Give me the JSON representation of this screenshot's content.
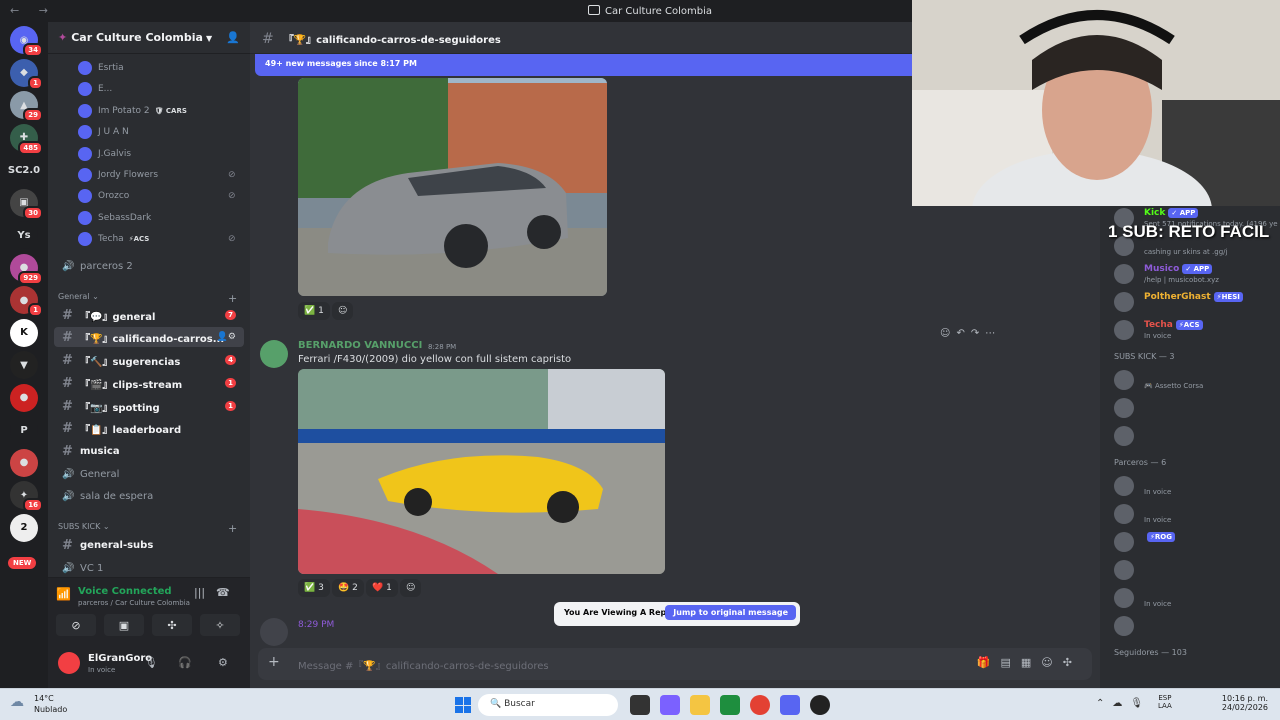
{
  "window": {
    "title": "Car Culture Colombia",
    "nav": "← →"
  },
  "rail": [
    {
      "label": "◉",
      "badge": "34",
      "color": "#5865f2"
    },
    {
      "label": "◆",
      "badge": "1",
      "color": "#3c5fae"
    },
    {
      "label": "▲",
      "badge": "29",
      "color": "#8a9aa8"
    },
    {
      "label": "✚",
      "badge": "485",
      "color": "#345e4a"
    },
    {
      "label": "SC2.0",
      "badge": "",
      "color": "#1e1f22"
    },
    {
      "label": "▣",
      "badge": "30",
      "color": "#444"
    },
    {
      "label": "Ys",
      "badge": "",
      "color": "#1e1f22"
    },
    {
      "label": "●",
      "badge": "929",
      "color": "#b04a9a"
    },
    {
      "label": "●",
      "badge": "1",
      "color": "#a33"
    },
    {
      "label": "K",
      "badge": "",
      "color": "#fff"
    },
    {
      "label": "▼",
      "badge": "",
      "color": "#222"
    },
    {
      "label": "●",
      "badge": "",
      "color": "#c22"
    },
    {
      "label": "P",
      "badge": "",
      "color": "#1e1f22"
    },
    {
      "label": "●",
      "badge": "",
      "color": "#c44"
    },
    {
      "label": "✦",
      "badge": "16",
      "color": "#333"
    },
    {
      "label": "2",
      "badge": "",
      "color": "#eee"
    }
  ],
  "rail_new": "NEW",
  "server": {
    "name": "Car Culture Colombia"
  },
  "voice_users": [
    {
      "name": "Esrtia",
      "tag": "",
      "muted": false
    },
    {
      "name": "E...",
      "tag": "",
      "muted": false
    },
    {
      "name": "Im Potato 2",
      "tag": "🛡 CARS",
      "muted": false
    },
    {
      "name": "J U A N",
      "tag": "",
      "muted": false
    },
    {
      "name": "J.Galvis",
      "tag": "",
      "muted": false
    },
    {
      "name": "Jordy Flowers",
      "tag": "",
      "muted": true
    },
    {
      "name": "Orozco",
      "tag": "",
      "muted": true
    },
    {
      "name": "SebassDark",
      "tag": "",
      "muted": false
    },
    {
      "name": "Techa",
      "tag": "⚡ACS",
      "muted": true
    }
  ],
  "channels": {
    "parceros2": "parceros 2",
    "cat_general": "General",
    "general": "『💬』general",
    "calificando": "『🏆』calificando-carros...",
    "sugerencias": "『🔨』sugerencias",
    "sugerencias_count": "4",
    "general_count": "7",
    "clips": "『🎬』clips-stream",
    "clips_count": "1",
    "spotting": "『📷』spotting",
    "spotting_count": "1",
    "leaderboard": "『📋』leaderboard",
    "musica": "musica",
    "general_voice": "General",
    "sala": "sala de espera",
    "cat_subs": "SUBS KICK",
    "general_subs": "general-subs",
    "vc1": "VC 1"
  },
  "voice": {
    "status": "Voice Connected",
    "location": "parceros / Car Culture Colombia"
  },
  "user": {
    "name": "ElGranGoro",
    "status": "In voice"
  },
  "chat": {
    "channel_title": "『🏆』calificando-carros-de-seguidores",
    "new_messages": "49+ new messages since 8:17 PM",
    "reactions1": [
      {
        "emoji": "✅",
        "count": "1"
      }
    ],
    "message": {
      "author": "BERNARDO VANNUCCI",
      "time": "8:28 PM",
      "text": "Ferrari /F430/(2009) dio yellow con full sistem capristo"
    },
    "reactions2": [
      {
        "emoji": "✅",
        "count": "3"
      },
      {
        "emoji": "🤩",
        "count": "2"
      },
      {
        "emoji": "❤️",
        "count": "1"
      }
    ],
    "peek_time": "8:29 PM",
    "reply_notice": "You Are Viewing A Reply.",
    "jump_label": "Jump to original message",
    "composer_placeholder": "Message #『🏆』calificando-carros-de-seguidores"
  },
  "members": {
    "top": [
      {
        "name": "Kick",
        "badge": "✓ APP",
        "sub": "Sent 571 notifications today. (4196 ye",
        "color": "#53fc18"
      },
      {
        "name": "",
        "badge": "",
        "sub": "cashing ur skins at .gg/j",
        "color": "#a779ff"
      },
      {
        "name": "Musico",
        "badge": "✓ APP",
        "sub": "/help | musicobot.xyz",
        "color": "#8e5bd8"
      },
      {
        "name": "PoltherGhast",
        "badge": "⚡HESI",
        "sub": "",
        "color": "#f0b232"
      },
      {
        "name": "Techa",
        "badge": "⚡ACS",
        "sub": "In voice",
        "color": "#e5534b"
      }
    ],
    "subs_header": "SUBS KICK — 3",
    "subs": [
      {
        "name": "",
        "sub": "🎮 Assetto Corsa"
      },
      {
        "name": "",
        "sub": ""
      },
      {
        "name": "",
        "sub": ""
      }
    ],
    "parceros_header": "Parceros — 6",
    "parceros": [
      {
        "sub": "In voice"
      },
      {
        "sub": "In voice"
      },
      {
        "sub": "",
        "badge": "⚡ROG"
      },
      {
        "sub": ""
      },
      {
        "sub": "In voice"
      },
      {
        "sub": ""
      }
    ],
    "seguidores_header": "Seguidores — 103"
  },
  "overlay": {
    "sub_goal": "1 SUB: RETO FACIL"
  },
  "taskbar": {
    "temp": "14°C",
    "weather": "Nublado",
    "search": "Buscar",
    "lang1": "ESP",
    "lang2": "LAA",
    "time": "10:16 p. m.",
    "date": "24/02/2026"
  }
}
